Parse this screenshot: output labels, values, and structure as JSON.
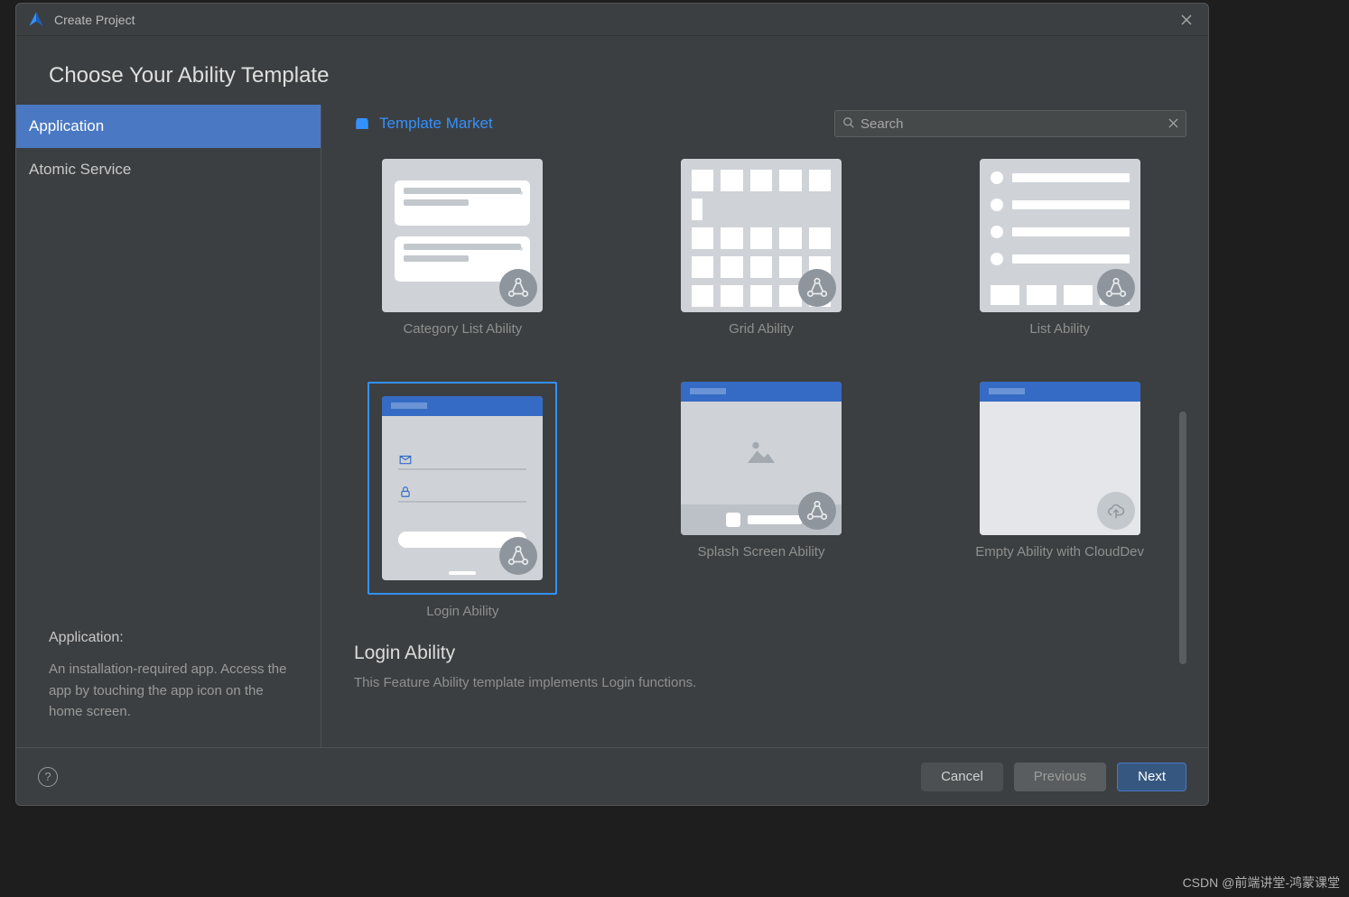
{
  "window": {
    "title": "Create Project"
  },
  "heading": "Choose Your Ability Template",
  "sidebar": {
    "tabs": [
      {
        "label": "Application",
        "active": true
      },
      {
        "label": "Atomic Service",
        "active": false
      }
    ],
    "info_title": "Application:",
    "info_desc": "An installation-required app. Access the app by touching the app icon on the home screen."
  },
  "toolbar": {
    "market_label": "Template Market",
    "search_placeholder": "Search"
  },
  "templates": [
    {
      "label": "Category List Ability",
      "kind": "category",
      "selected": false
    },
    {
      "label": "Grid Ability",
      "kind": "grid",
      "selected": false
    },
    {
      "label": "List Ability",
      "kind": "list",
      "selected": false
    },
    {
      "label": "Login Ability",
      "kind": "login",
      "selected": true
    },
    {
      "label": "Splash Screen Ability",
      "kind": "splash",
      "selected": false
    },
    {
      "label": "Empty Ability with CloudDev",
      "kind": "cloud",
      "selected": false
    }
  ],
  "detail": {
    "title": "Login Ability",
    "desc": "This Feature Ability template implements Login functions."
  },
  "footer": {
    "cancel": "Cancel",
    "previous": "Previous",
    "next": "Next"
  },
  "watermark": "CSDN @前端讲堂-鸿蒙课堂"
}
